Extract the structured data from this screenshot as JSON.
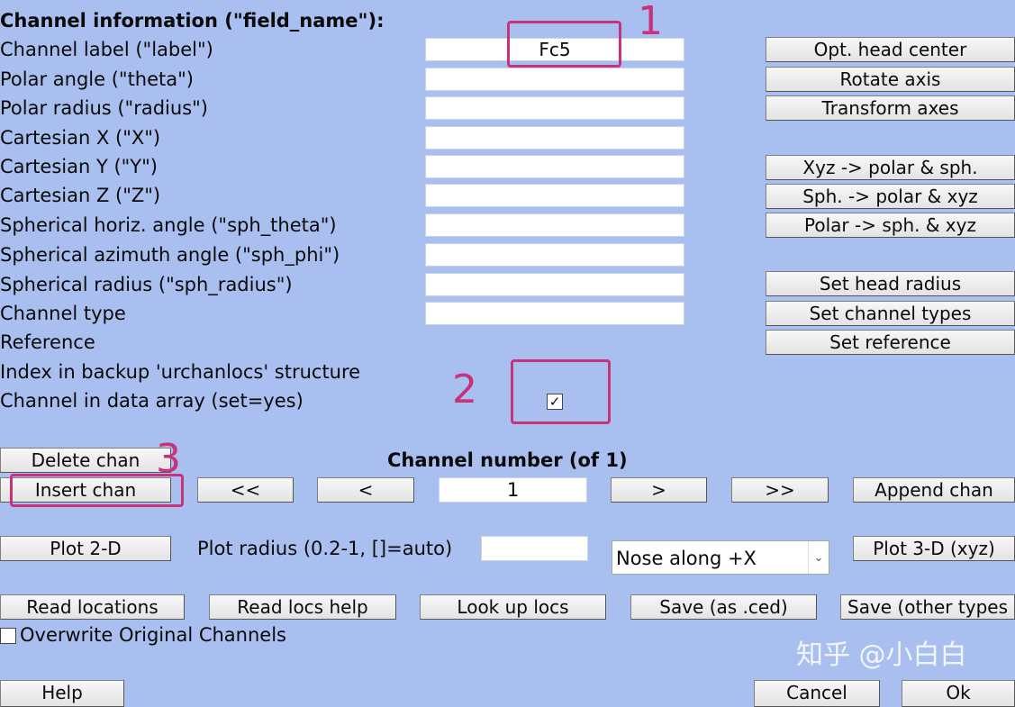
{
  "labels": {
    "header": "Channel information (\"field_name\"):",
    "label": "Channel label (\"label\")",
    "theta": "Polar angle (\"theta\")",
    "radius": "Polar radius (\"radius\")",
    "x": "Cartesian X (\"X\")",
    "y": "Cartesian Y (\"Y\")",
    "z": "Cartesian Z (\"Z\")",
    "sph_theta": "Spherical horiz. angle (\"sph_theta\")",
    "sph_phi": "Spherical azimuth angle (\"sph_phi\")",
    "sph_radius": "Spherical radius (\"sph_radius\")",
    "type": "Channel type",
    "ref": "Reference",
    "urchan": "Index in backup 'urchanlocs' structure",
    "datachan": "Channel in data array (set=yes)"
  },
  "fields": {
    "label": "Fc5",
    "theta": "",
    "radius": "",
    "x": "",
    "y": "",
    "z": "",
    "sph_theta": "",
    "sph_phi": "",
    "sph_radius": "",
    "type": ""
  },
  "right_buttons": {
    "opt_head": "Opt. head center",
    "rotate": "Rotate axis",
    "transform": "Transform axes",
    "xyz_polar": "Xyz -> polar & sph.",
    "sph_polar": "Sph. -> polar & xyz",
    "polar_sph": "Polar -> sph. & xyz",
    "head_radius": "Set head radius",
    "chan_types": "Set channel types",
    "reference": "Set reference"
  },
  "datachan_checked": "✓",
  "nav": {
    "delete": "Delete chan",
    "insert": "Insert chan",
    "channel_number_label": "Channel number (of 1)",
    "first": "<<",
    "prev": "<",
    "current": "1",
    "next": ">",
    "last": ">>",
    "append": "Append chan"
  },
  "plot": {
    "plot2d": "Plot 2-D",
    "radius_label": "Plot radius (0.2-1, []=auto)",
    "radius_value": "",
    "nose": "Nose along +X",
    "plot3d": "Plot 3-D (xyz)"
  },
  "file": {
    "read": "Read locations",
    "read_help": "Read locs help",
    "lookup": "Look up locs",
    "save_ced": "Save (as .ced)",
    "save_other": "Save (other types"
  },
  "overwrite_label": "Overwrite Original Channels",
  "bottom": {
    "help": "Help",
    "cancel": "Cancel",
    "ok": "Ok"
  },
  "annotations": {
    "one": "1",
    "two": "2",
    "three": "3"
  },
  "watermark": "知乎 @小白白",
  "colors": {
    "background": "#a8bff0",
    "annotation": "#c8327a"
  }
}
